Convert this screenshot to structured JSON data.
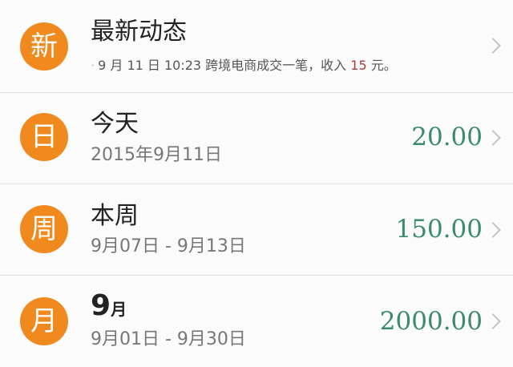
{
  "latest": {
    "icon_char": "新",
    "title": "最新动态",
    "news_dot": "·",
    "news_text": "9 月 11 日 10:23 跨境电商成交一笔，收入",
    "news_amount": "15",
    "news_suffix": "元。"
  },
  "today": {
    "icon_char": "日",
    "title": "今天",
    "date": "2015年9月11日",
    "amount": "20.00"
  },
  "week": {
    "icon_char": "周",
    "title": "本周",
    "range": "9月07日 - 9月13日",
    "amount": "150.00"
  },
  "month": {
    "icon_char": "月",
    "title_number": "9",
    "title_unit": "月",
    "range": "9月01日 - 9月30日",
    "amount": "2000.00"
  },
  "colors": {
    "icon_bg": "#f08a1e",
    "amount_green": "#3a8a6c",
    "news_highlight": "#b23a3a",
    "chevron": "#c4c4c4"
  },
  "icons": {
    "row_arrow": "chevron-right-icon"
  }
}
